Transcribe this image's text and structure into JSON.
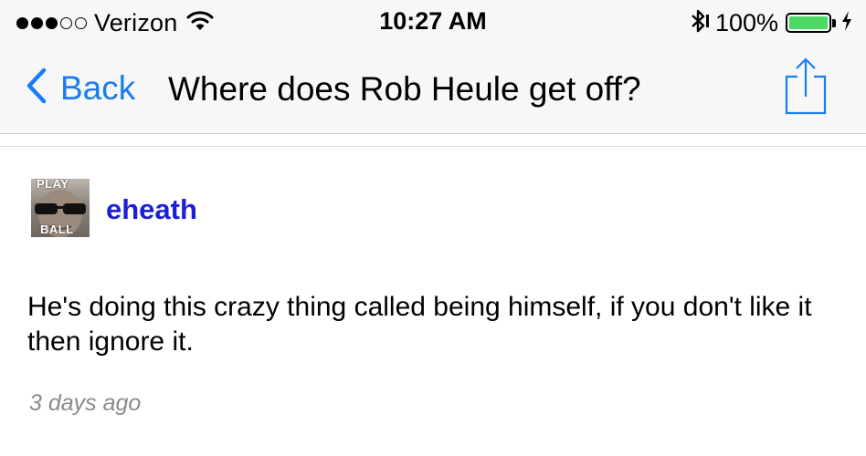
{
  "status_bar": {
    "signal_bars_filled": 3,
    "signal_bars_total": 5,
    "carrier": "Verizon",
    "wifi_icon": "wifi-icon",
    "time": "10:27 AM",
    "bluetooth_icon": "bluetooth-icon",
    "battery_percent": "100%",
    "battery_level": 1.0,
    "battery_color": "#4cd964",
    "charging_icon": "charging-bolt-icon"
  },
  "nav": {
    "back_label": "Back",
    "title": "Where does Rob Heule get off?",
    "share_icon": "share-icon",
    "accent_color": "#1a7cf3"
  },
  "post": {
    "avatar_text_top": "PLAY",
    "avatar_text_bottom": "BALL",
    "username": "eheath",
    "username_color": "#1d1fd4",
    "body": "He's doing this crazy thing called being himself, if you don't like it then ignore it.",
    "timestamp": "3 days ago"
  }
}
